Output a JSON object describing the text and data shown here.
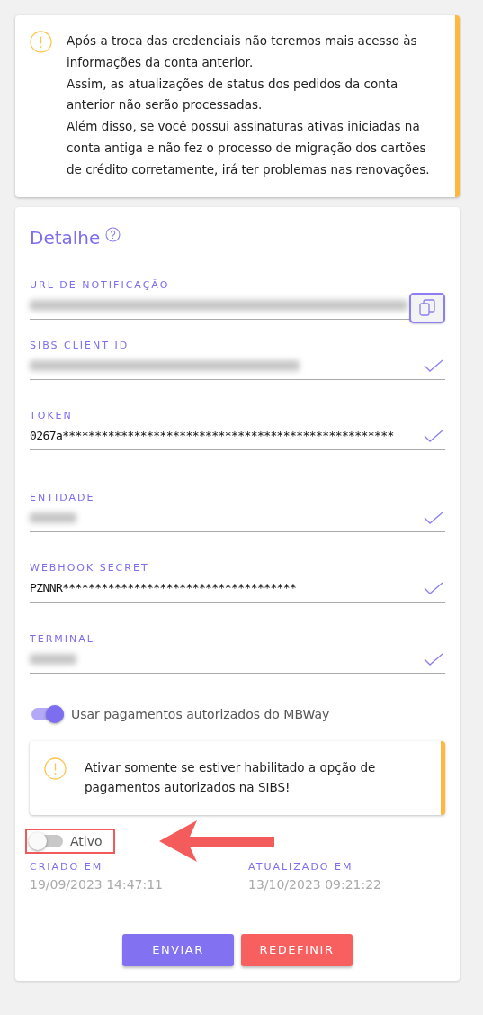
{
  "notice": {
    "lines": [
      "Após a troca das credenciais não teremos mais acesso às informações da conta anterior.",
      "Assim, as atualizações de status dos pedidos da conta anterior não serão processadas.",
      "Além disso, se você possui assinaturas ativas iniciadas na conta antiga e não fez o processo de migração dos cartões de crédito corretamente, irá ter problemas nas renovações."
    ]
  },
  "detail": {
    "title": "Detalhe",
    "fields": [
      {
        "label": "URL DE NOTIFICAÇÃO",
        "kind": "copy",
        "content": {
          "kind": "blurred_long"
        }
      },
      {
        "label": "SIBS CLIENT ID",
        "kind": "check",
        "content": {
          "kind": "blurred_medium"
        }
      },
      {
        "label": "TOKEN",
        "kind": "check",
        "content": {
          "kind": "text",
          "text": "0267a***************************************************"
        }
      },
      {
        "label": "ENTIDADE",
        "kind": "check",
        "content": {
          "kind": "blurred_short"
        }
      },
      {
        "label": "WEBHOOK SECRET",
        "kind": "check",
        "content": {
          "kind": "text",
          "text": "PZNNR************************************"
        }
      },
      {
        "label": "TERMINAL",
        "kind": "check",
        "content": {
          "kind": "blurred_short"
        }
      }
    ],
    "mbway_toggle": {
      "label": "Usar pagamentos autorizados do MBWay",
      "on": true
    },
    "mbway_notice": {
      "text": "Ativar somente se estiver habilitado a opção de pagamentos autorizados na SIBS!"
    },
    "active_toggle": {
      "label": "Ativo",
      "on": false
    },
    "dates": [
      {
        "label": "CRIADO EM",
        "value": "19/09/2023 14:47:11"
      },
      {
        "label": "ATUALIZADO EM",
        "value": "13/10/2023 09:21:22"
      }
    ],
    "buttons": [
      {
        "label": "ENVIAR",
        "kind": "primary"
      },
      {
        "label": "REDEFINIR",
        "kind": "danger"
      }
    ]
  }
}
